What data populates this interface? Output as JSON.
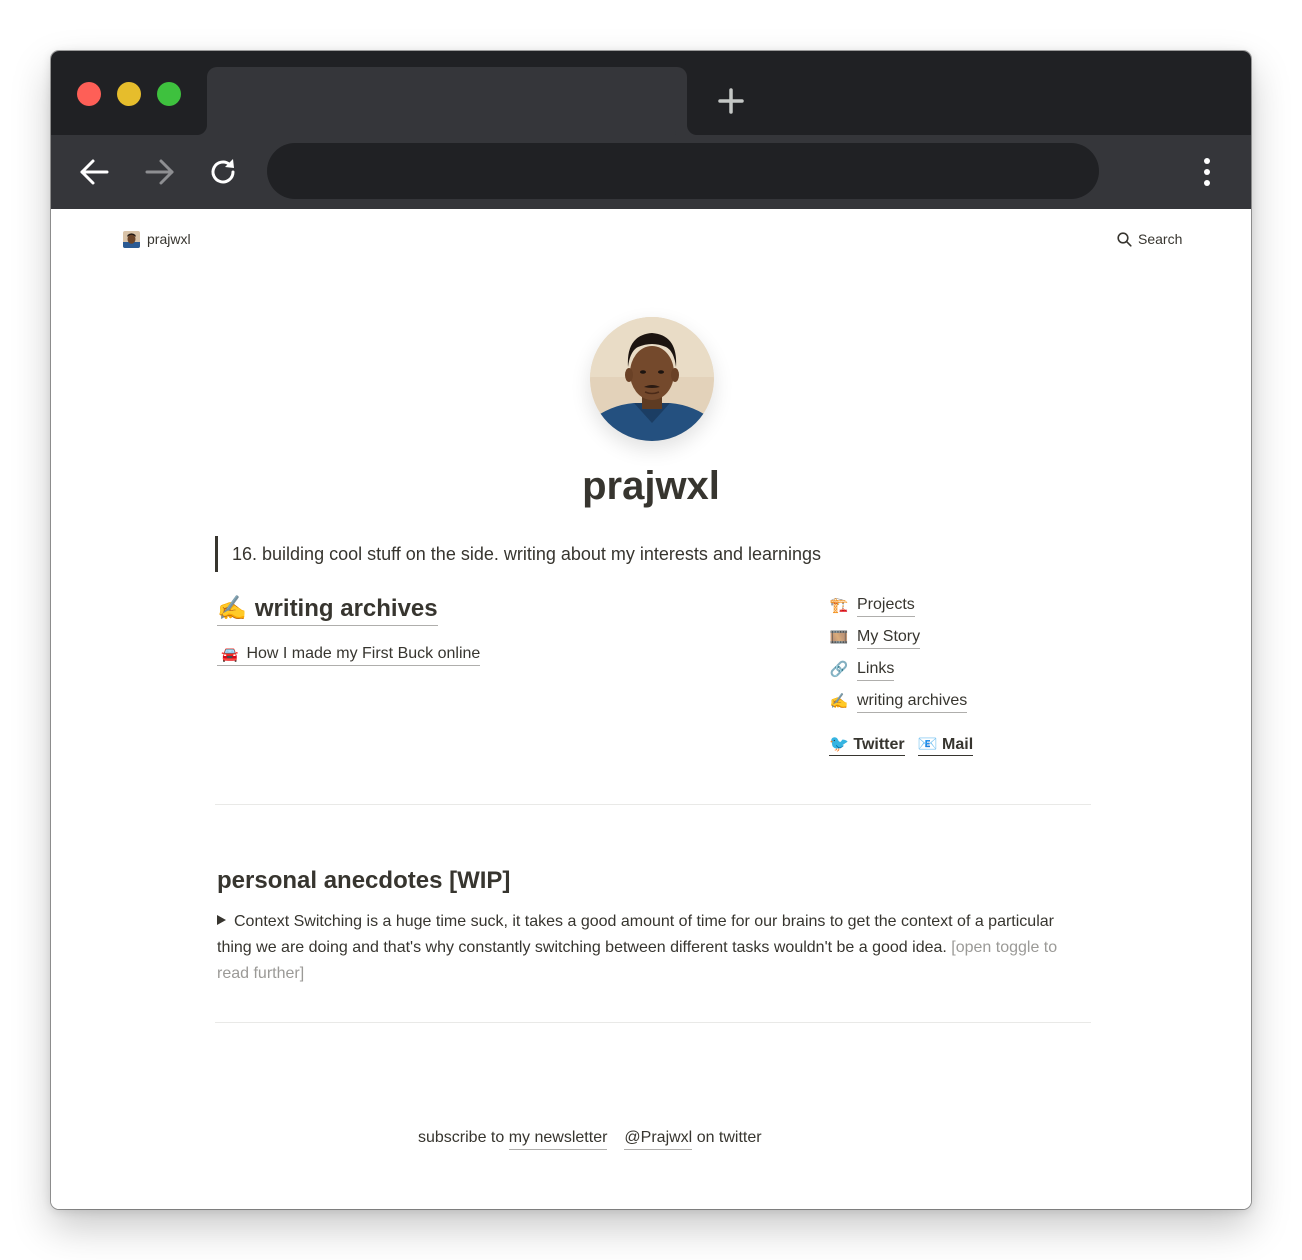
{
  "browser": {
    "tab_title": "",
    "address": "",
    "icons": {
      "new_tab": "plus-icon",
      "back": "arrow-left-icon",
      "forward": "arrow-right-icon",
      "reload": "reload-icon",
      "menu": "more-vertical-icon"
    },
    "colors": {
      "titlebar": "#202124",
      "toolbar": "#35363a",
      "close": "#fe5f57",
      "minimize": "#e6bd2c",
      "maximize": "#3ec13e"
    }
  },
  "topbar": {
    "site_name": "prajwxl",
    "search_label": "Search"
  },
  "profile": {
    "title": "prajwxl",
    "bio": "16. building cool stuff on the side. writing about my interests and learnings"
  },
  "archives": {
    "emoji": "✍️",
    "heading": "writing archives",
    "posts": [
      {
        "emoji": "🚘",
        "title": "How I made my First Buck online"
      }
    ]
  },
  "side_nav": {
    "items": [
      {
        "emoji": "🏗️",
        "label": "Projects"
      },
      {
        "emoji": "🎞️",
        "label": "My Story"
      },
      {
        "emoji": "🔗",
        "label": "Links"
      },
      {
        "emoji": "✍️",
        "label": "writing archives"
      }
    ],
    "social": [
      {
        "emoji": "🐦",
        "label": "Twitter"
      },
      {
        "emoji": "📧",
        "label": "Mail"
      }
    ]
  },
  "anecdotes": {
    "heading": "personal anecdotes [WIP]",
    "text": "Context Switching is a huge time suck, it takes a good amount of time for our brains to get the context of a particular thing we are doing and that's why constantly switching between different tasks wouldn't be a good idea.",
    "hint": "[open toggle to read further]"
  },
  "footer": {
    "prefix": "subscribe to",
    "newsletter_link": "my newsletter",
    "twitter_handle": "@Prajwxl",
    "twitter_suffix": "on twitter"
  }
}
